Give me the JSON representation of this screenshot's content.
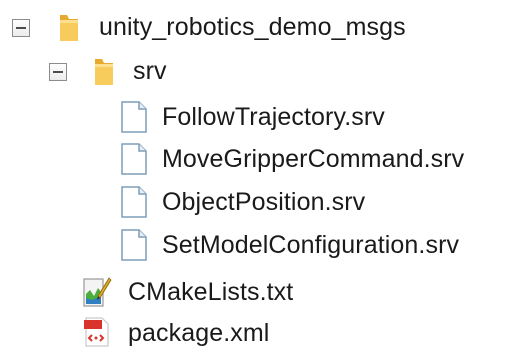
{
  "tree": {
    "root": {
      "label": "unity_robotics_demo_msgs",
      "expanded": true,
      "icon": "folder-icon",
      "children": {
        "srv_folder": {
          "label": "srv",
          "expanded": true,
          "icon": "folder-icon",
          "files": [
            {
              "label": "FollowTrajectory.srv",
              "icon": "text-file-icon"
            },
            {
              "label": "MoveGripperCommand.srv",
              "icon": "text-file-icon"
            },
            {
              "label": "ObjectPosition.srv",
              "icon": "text-file-icon"
            },
            {
              "label": "SetModelConfiguration.srv",
              "icon": "text-file-icon"
            }
          ]
        },
        "cmake": {
          "label": "CMakeLists.txt",
          "icon": "cmake-file-icon"
        },
        "package": {
          "label": "package.xml",
          "icon": "xml-file-icon"
        }
      }
    }
  },
  "colors": {
    "folder": "#f5c24c",
    "text": "#1a1a1a",
    "file_border": "#7f9db9",
    "xml_red": "#d9342b",
    "cmake_green": "#4cae3c"
  }
}
